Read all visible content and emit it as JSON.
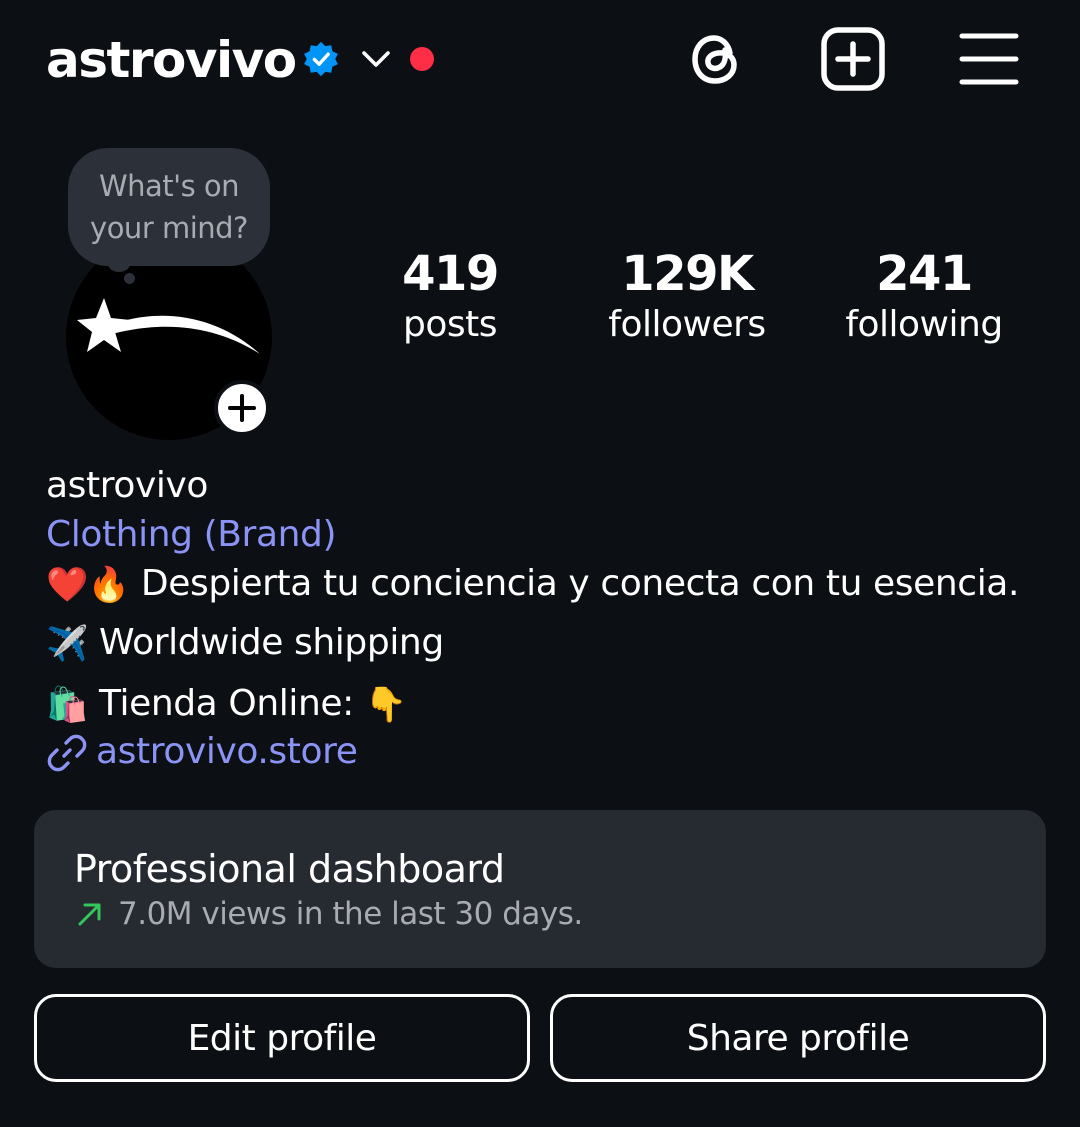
{
  "header": {
    "username": "astrovivo",
    "icons": {
      "verified": "verified-badge-icon",
      "switch_account": "chevron-down-icon",
      "notification": "red-dot",
      "threads": "threads-icon",
      "create": "plus-square-icon",
      "menu": "hamburger-menu-icon"
    }
  },
  "profile": {
    "note_bubble": {
      "line1": "What's on",
      "line2": "your mind?"
    },
    "avatar_icon": "shooting-star-icon",
    "add_story_icon": "plus-icon"
  },
  "stats": [
    {
      "value": "419",
      "label": "posts"
    },
    {
      "value": "129K",
      "label": "followers"
    },
    {
      "value": "241",
      "label": "following"
    }
  ],
  "bio": {
    "name": "astrovivo",
    "category": "Clothing (Brand)",
    "line1": {
      "emojis": "❤️🔥",
      "text": "Despierta tu conciencia y conecta con tu esencia."
    },
    "line2": {
      "emoji": "✈️",
      "text": "Worldwide shipping"
    },
    "line3": {
      "emoji": "🛍️",
      "text": "Tienda Online:",
      "emoji_after": "👇"
    },
    "link": {
      "icon": "link-icon",
      "text": "astrovivo.store"
    }
  },
  "dashboard": {
    "title": "Professional dashboard",
    "subtitle": "7.0M views in the last 30 days.",
    "trend_icon": "trend-up-arrow-icon"
  },
  "buttons": {
    "edit": "Edit profile",
    "share": "Share profile"
  },
  "colors": {
    "background": "#0c0f14",
    "accent": "#8b93f5",
    "verified": "#0095f6",
    "notification": "#ff2d45",
    "trend": "#34c759",
    "card": "#262a31"
  }
}
